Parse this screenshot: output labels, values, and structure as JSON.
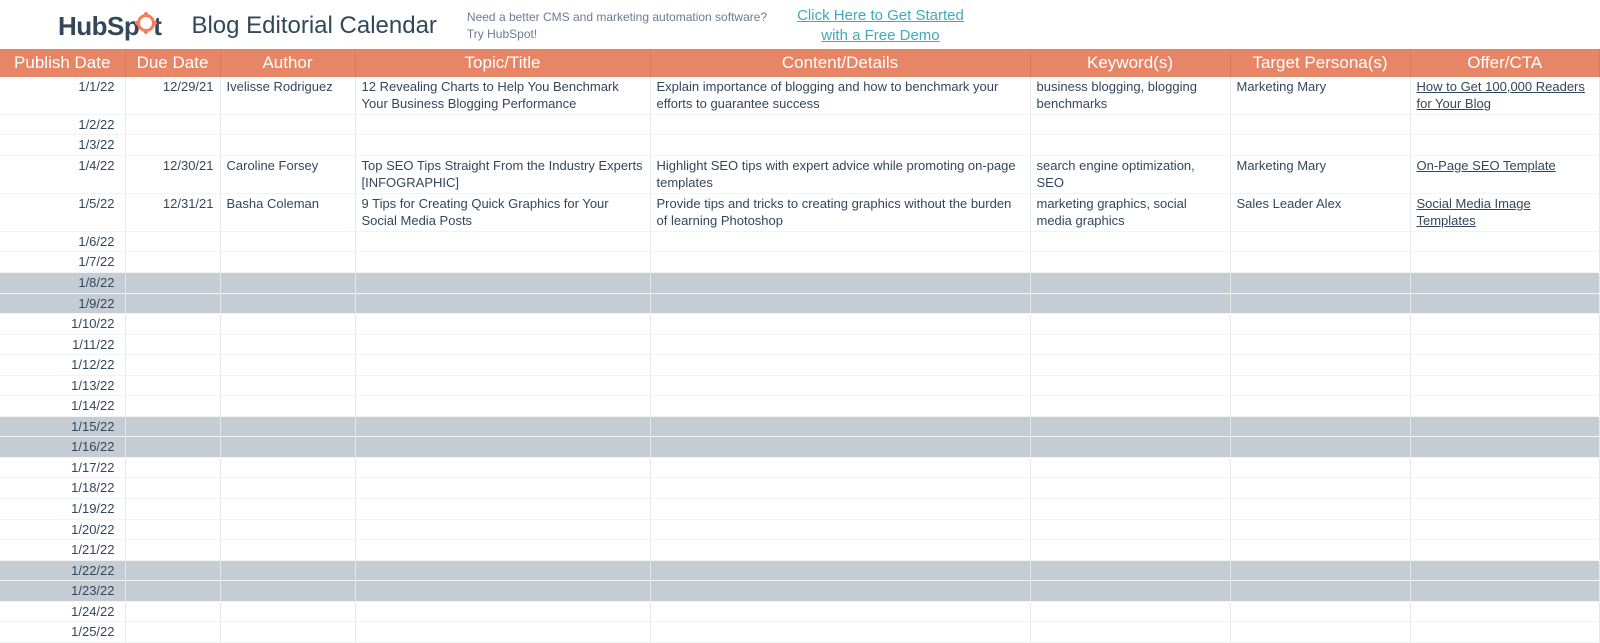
{
  "header": {
    "logo_prefix": "HubSp",
    "logo_suffix": "t",
    "title": "Blog Editorial Calendar",
    "promo_line1": "Need a better CMS and marketing automation software?",
    "promo_line2": "Try HubSpot!",
    "cta_line1": "Click Here to Get Started",
    "cta_line2": "with a Free Demo"
  },
  "columns": {
    "publish_date": "Publish Date",
    "due_date": "Due Date",
    "author": "Author",
    "topic": "Topic/Title",
    "content": "Content/Details",
    "keywords": "Keyword(s)",
    "persona": "Target Persona(s)",
    "offer": "Offer/CTA"
  },
  "rows": [
    {
      "publish": "1/1/22",
      "due": "12/29/21",
      "author": "Ivelisse Rodriguez",
      "topic": "12 Revealing Charts to Help You Benchmark Your Business Blogging Performance",
      "content": "Explain importance of blogging and how to benchmark your efforts to guarantee success",
      "keywords": "business blogging, blogging benchmarks",
      "persona": "Marketing Mary",
      "offer": "How to Get 100,000 Readers for Your Blog",
      "offer_link": true
    },
    {
      "publish": "1/2/22"
    },
    {
      "publish": "1/3/22"
    },
    {
      "publish": "1/4/22",
      "due": "12/30/21",
      "author": "Caroline Forsey",
      "topic": "Top SEO Tips Straight From the Industry Experts [INFOGRAPHIC]",
      "content": "Highlight SEO tips with expert advice while promoting on-page templates",
      "keywords": "search engine optimization, SEO",
      "persona": "Marketing Mary",
      "offer": "On-Page SEO Template",
      "offer_link": true
    },
    {
      "publish": "1/5/22",
      "due": "12/31/21",
      "author": "Basha Coleman",
      "topic": "9 Tips for Creating Quick Graphics for Your Social Media Posts",
      "content": "Provide tips and tricks to creating graphics without the burden of learning Photoshop",
      "keywords": "marketing graphics, social media graphics",
      "persona": "Sales Leader Alex",
      "offer": "Social Media Image Templates",
      "offer_link": true
    },
    {
      "publish": "1/6/22"
    },
    {
      "publish": "1/7/22"
    },
    {
      "publish": "1/8/22",
      "shaded": true
    },
    {
      "publish": "1/9/22",
      "shaded": true
    },
    {
      "publish": "1/10/22"
    },
    {
      "publish": "1/11/22"
    },
    {
      "publish": "1/12/22"
    },
    {
      "publish": "1/13/22"
    },
    {
      "publish": "1/14/22"
    },
    {
      "publish": "1/15/22",
      "shaded": true
    },
    {
      "publish": "1/16/22",
      "shaded": true
    },
    {
      "publish": "1/17/22"
    },
    {
      "publish": "1/18/22"
    },
    {
      "publish": "1/19/22"
    },
    {
      "publish": "1/20/22"
    },
    {
      "publish": "1/21/22"
    },
    {
      "publish": "1/22/22",
      "shaded": true
    },
    {
      "publish": "1/23/22",
      "shaded": true
    },
    {
      "publish": "1/24/22"
    },
    {
      "publish": "1/25/22"
    }
  ]
}
